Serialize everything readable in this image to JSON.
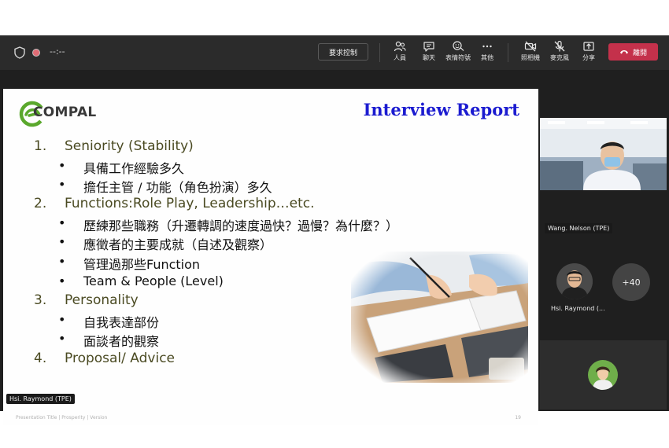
{
  "topbar": {
    "timer": "--:--",
    "request_control": "要求控制",
    "tools": [
      {
        "icon": "people-icon",
        "label": "人員"
      },
      {
        "icon": "chat-icon",
        "label": "聊天"
      },
      {
        "icon": "reactions-icon",
        "label": "表情符號"
      },
      {
        "icon": "more-icon",
        "label": "其他"
      },
      {
        "icon": "camera-off-icon",
        "label": "照相機"
      },
      {
        "icon": "mic-off-icon",
        "label": "麥克風"
      },
      {
        "icon": "share-icon",
        "label": "分享"
      }
    ],
    "leave": "離開",
    "leave_color": "#c4314b"
  },
  "slide": {
    "logo_text": "COMPAL",
    "title": "Interview Report",
    "title_color": "#1b1bd0",
    "items": [
      {
        "num": "1.",
        "text": "Seniority (Stability)",
        "bullets": [
          "具備工作經驗多久",
          "擔任主管 / 功能（角色扮演）多久"
        ]
      },
      {
        "num": "2.",
        "text": "Functions:Role Play, Leadership…etc.",
        "bullets": [
          "歷練那些職務（升遷轉調的速度過快？過慢？為什麼？）",
          "應徵者的主要成就（自述及觀察）",
          "管理過那些Function",
          "Team & People (Level)"
        ]
      },
      {
        "num": "3.",
        "text": "Personality",
        "bullets": [
          "自我表達部份",
          "面談者的觀察"
        ]
      },
      {
        "num": "4.",
        "text": "Proposal/ Advice",
        "bullets": []
      }
    ],
    "footer": "Presentation Title | Prosperity | Version",
    "page_number": "19"
  },
  "presenter_name": "Hsi. Raymond (TPE)",
  "participants": {
    "video_name": "Wang. Nelson (TPE)",
    "avatar_name": "Hsi. Raymond (...",
    "more_count": "+40"
  }
}
